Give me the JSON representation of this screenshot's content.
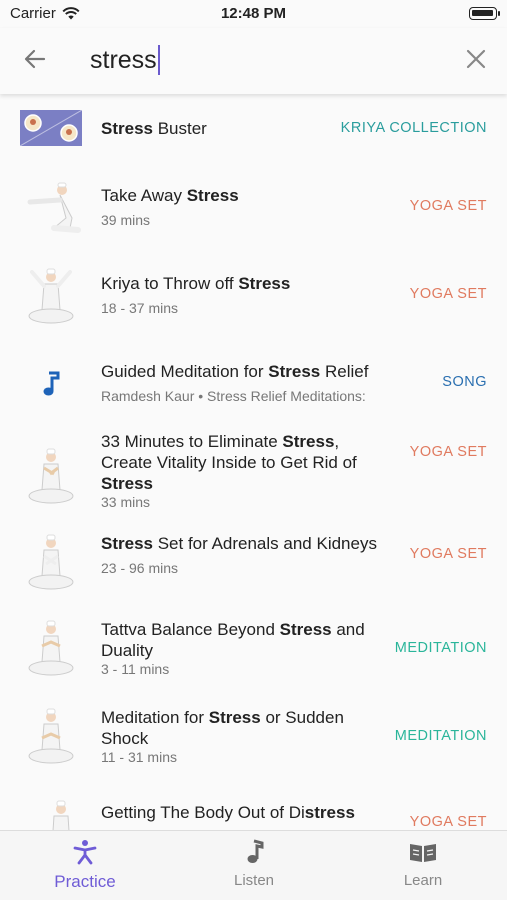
{
  "status": {
    "carrier": "Carrier",
    "time": "12:48 PM"
  },
  "search": {
    "query": "stress"
  },
  "results": [
    {
      "pre": "",
      "bold": "Stress",
      "post": " Buster",
      "bold2": "",
      "post2": "",
      "sub": "",
      "tag": "KRIYA COLLECTION"
    },
    {
      "pre": "Take Away ",
      "bold": "Stress",
      "post": "",
      "bold2": "",
      "post2": "",
      "sub": "39 mins",
      "tag": "YOGA SET"
    },
    {
      "pre": "Kriya to Throw off ",
      "bold": "Stress",
      "post": "",
      "bold2": "",
      "post2": "",
      "sub": "18 - 37 mins",
      "tag": "YOGA SET"
    },
    {
      "pre": "Guided Meditation for ",
      "bold": "Stress",
      "post": " Relief",
      "bold2": "",
      "post2": "",
      "sub": "Ramdesh Kaur • Stress Relief Meditations:",
      "tag": "SONG"
    },
    {
      "pre": "33 Minutes to Eliminate ",
      "bold": "Stress",
      "post": ", Create Vitality Inside to Get Rid of ",
      "bold2": "Stress",
      "post2": "",
      "sub": "33 mins",
      "tag": "YOGA SET"
    },
    {
      "pre": "",
      "bold": "Stress",
      "post": " Set for Adrenals and Kidneys",
      "bold2": "",
      "post2": "",
      "sub": "23 - 96 mins",
      "tag": "YOGA SET"
    },
    {
      "pre": "Tattva Balance Beyond ",
      "bold": "Stress",
      "post": " and Duality",
      "bold2": "",
      "post2": "",
      "sub": "3 - 11 mins",
      "tag": "MEDITATION"
    },
    {
      "pre": "Meditation for ",
      "bold": "Stress",
      "post": " or Sudden Shock",
      "bold2": "",
      "post2": "",
      "sub": "11 - 31 mins",
      "tag": "MEDITATION"
    },
    {
      "pre": "Getting The Body Out of Di",
      "bold": "stress",
      "post": "",
      "bold2": "",
      "post2": "",
      "sub": "",
      "tag": "YOGA SET"
    }
  ],
  "tabs": [
    {
      "label": "Practice",
      "icon": "person-pose-icon",
      "active": true
    },
    {
      "label": "Listen",
      "icon": "music-note-icon",
      "active": false
    },
    {
      "label": "Learn",
      "icon": "open-book-icon",
      "active": false
    }
  ],
  "colors": {
    "accent": "#6f5cd6",
    "yoga": "#e07a5f",
    "kriya": "#2a9d9d",
    "song": "#2a6fb0",
    "meditation": "#2ab59a"
  }
}
